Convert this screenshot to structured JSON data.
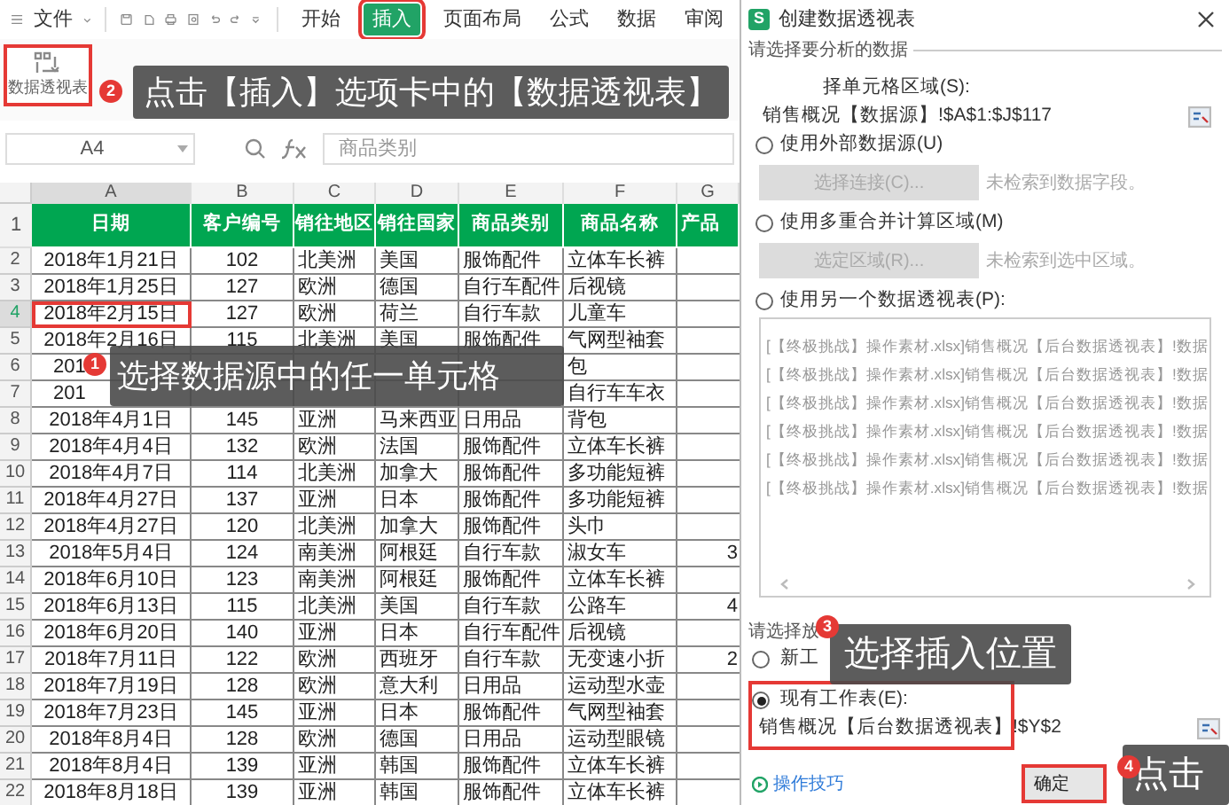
{
  "menu": {
    "file_label": "文件",
    "tabs": [
      {
        "label": "开始",
        "selected": false
      },
      {
        "label": "插入",
        "selected": true
      },
      {
        "label": "页面布局",
        "selected": false
      },
      {
        "label": "公式",
        "selected": false
      },
      {
        "label": "数据",
        "selected": false
      },
      {
        "label": "审阅",
        "selected": false
      }
    ]
  },
  "ribbon": {
    "pivot_button": "数据透视表"
  },
  "formula_bar": {
    "name_box": "A4",
    "formula": "商品类别"
  },
  "sheet": {
    "columns": [
      "A",
      "B",
      "C",
      "D",
      "E",
      "F",
      "G"
    ],
    "header_row": {
      "number": "1",
      "cells": [
        "日期",
        "客户编号",
        "销往地区",
        "销往国家",
        "商品类别",
        "商品名称",
        "产品"
      ]
    },
    "rows": [
      {
        "number": "2",
        "selected": false,
        "cells": [
          "2018年1月21日",
          "102",
          "北美洲",
          "美国",
          "服饰配件",
          "立体车长裤"
        ]
      },
      {
        "number": "3",
        "selected": false,
        "cells": [
          "2018年1月25日",
          "127",
          "欧洲",
          "德国",
          "自行车配件",
          "后视镜"
        ]
      },
      {
        "number": "4",
        "selected": true,
        "cells": [
          "2018年2月15日",
          "127",
          "欧洲",
          "荷兰",
          "自行车款",
          "儿童车"
        ]
      },
      {
        "number": "5",
        "selected": false,
        "cells": [
          "2018年2月16日",
          "115",
          "北美洲",
          "美国",
          "服饰配件",
          "气网型袖套"
        ]
      },
      {
        "number": "6",
        "selected": false,
        "cells": [
          "201",
          null,
          null,
          null,
          null,
          "包"
        ]
      },
      {
        "number": "7",
        "selected": false,
        "cells": [
          "201",
          null,
          null,
          null,
          null,
          "自行车车衣"
        ]
      },
      {
        "number": "8",
        "selected": false,
        "cells": [
          "2018年4月1日",
          "145",
          "亚洲",
          "马来西亚",
          "日用品",
          "背包"
        ]
      },
      {
        "number": "9",
        "selected": false,
        "cells": [
          "2018年4月4日",
          "132",
          "欧洲",
          "法国",
          "服饰配件",
          "立体车长裤"
        ]
      },
      {
        "number": "10",
        "selected": false,
        "cells": [
          "2018年4月7日",
          "114",
          "北美洲",
          "加拿大",
          "服饰配件",
          "多功能短裤"
        ]
      },
      {
        "number": "11",
        "selected": false,
        "cells": [
          "2018年4月27日",
          "137",
          "亚洲",
          "日本",
          "服饰配件",
          "多功能短裤"
        ]
      },
      {
        "number": "12",
        "selected": false,
        "cells": [
          "2018年4月27日",
          "120",
          "北美洲",
          "加拿大",
          "服饰配件",
          "头巾"
        ]
      },
      {
        "number": "13",
        "selected": false,
        "cells": [
          "2018年5月4日",
          "124",
          "南美洲",
          "阿根廷",
          "自行车款",
          "淑女车"
        ],
        "column_g": "3"
      },
      {
        "number": "14",
        "selected": false,
        "cells": [
          "2018年6月10日",
          "123",
          "南美洲",
          "阿根廷",
          "服饰配件",
          "立体车长裤"
        ]
      },
      {
        "number": "15",
        "selected": false,
        "cells": [
          "2018年6月13日",
          "115",
          "北美洲",
          "美国",
          "自行车款",
          "公路车"
        ],
        "column_g": "4"
      },
      {
        "number": "16",
        "selected": false,
        "cells": [
          "2018年6月20日",
          "140",
          "亚洲",
          "日本",
          "自行车配件",
          "后视镜"
        ]
      },
      {
        "number": "17",
        "selected": false,
        "cells": [
          "2018年7月11日",
          "122",
          "欧洲",
          "西班牙",
          "自行车款",
          "无变速小折"
        ],
        "column_g": "2"
      },
      {
        "number": "18",
        "selected": false,
        "cells": [
          "2018年7月19日",
          "128",
          "欧洲",
          "意大利",
          "日用品",
          "运动型水壶"
        ]
      },
      {
        "number": "19",
        "selected": false,
        "cells": [
          "2018年7月23日",
          "145",
          "亚洲",
          "日本",
          "服饰配件",
          "气网型袖套"
        ]
      },
      {
        "number": "20",
        "selected": false,
        "cells": [
          "2018年8月4日",
          "128",
          "欧洲",
          "德国",
          "日用品",
          "运动型眼镜"
        ]
      },
      {
        "number": "21",
        "selected": false,
        "cells": [
          "2018年8月4日",
          "139",
          "亚洲",
          "韩国",
          "服饰配件",
          "立体车长裤"
        ]
      },
      {
        "number": "22",
        "selected": false,
        "cells": [
          "2018年8月18日",
          "139",
          "亚洲",
          "韩国",
          "服饰配件",
          "立体车长裤"
        ]
      }
    ]
  },
  "dialog": {
    "logo_letter": "S",
    "title": "创建数据透视表",
    "source_label": "请选择要分析的数据",
    "options": [
      {
        "kind": "range",
        "label": "择单元格区域(S):",
        "value": "销售概况【数据源】!$A$1:$J$117"
      },
      {
        "kind": "button",
        "label": "使用外部数据源(U)",
        "selected": false,
        "button": "选择连接(C)...",
        "disabled": true,
        "hint": "未检索到数据字段。"
      },
      {
        "kind": "button",
        "label": "使用多重合并计算区域(M)",
        "selected": false,
        "button": "选定区域(R)...",
        "disabled": true,
        "hint": "未检索到选中区域。"
      },
      {
        "kind": "list",
        "label": "使用另一个数据透视表(P):",
        "selected": false,
        "items": [
          "[【终极挑战】操作素材.xlsx]销售概况【后台数据透视表】!数据",
          "[【终极挑战】操作素材.xlsx]销售概况【后台数据透视表】!数据",
          "[【终极挑战】操作素材.xlsx]销售概况【后台数据透视表】!数据",
          "[【终极挑战】操作素材.xlsx]销售概况【后台数据透视表】!数据",
          "[【终极挑战】操作素材.xlsx]销售概况【后台数据透视表】!数据",
          "[【终极挑战】操作素材.xlsx]销售概况【后台数据透视表】!数据"
        ]
      }
    ],
    "placement_label": "请选择放",
    "placement_options": [
      {
        "label": "新工",
        "selected": false
      },
      {
        "label": "现有工作表(E):",
        "selected": true,
        "value": "销售概况【后台数据透视表】!$Y$2"
      }
    ],
    "help_link": "操作技巧",
    "ok_button": "确定"
  },
  "callouts": [
    {
      "number": "2",
      "text": "点击【插入】选项卡中的【数据透视表】"
    },
    {
      "number": "1",
      "text": "选择数据源中的任一单元格"
    },
    {
      "number": "3",
      "text": "选择插入位置"
    },
    {
      "number": "4",
      "text": "点击"
    }
  ]
}
